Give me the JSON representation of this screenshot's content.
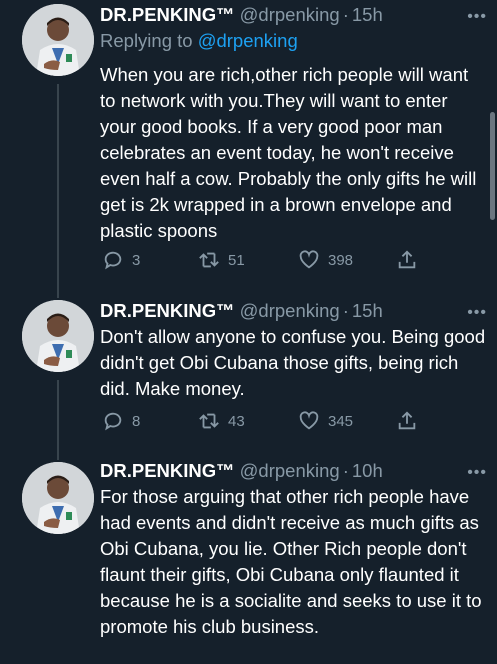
{
  "tweets": [
    {
      "name": "DR.PENKING™",
      "handle": "@drpenking",
      "sep": "·",
      "time": "15h",
      "reply_prefix": "Replying to ",
      "reply_to": "@drpenking",
      "text": "When you are rich,other rich people will want to network with you.They will want to enter your good books. If a very good poor man celebrates an event today, he won't receive even half a cow. Probably the only gifts he will get is 2k wrapped in a brown envelope and plastic spoons",
      "replies": "3",
      "retweets": "51",
      "likes": "398"
    },
    {
      "name": "DR.PENKING™",
      "handle": "@drpenking",
      "sep": "·",
      "time": "15h",
      "text": "Don't allow anyone to confuse you. Being good didn't get Obi Cubana those gifts, being rich did. Make money.",
      "replies": "8",
      "retweets": "43",
      "likes": "345"
    },
    {
      "name": "DR.PENKING™",
      "handle": "@drpenking",
      "sep": "·",
      "time": "10h",
      "text": "For those arguing that other rich people have had events and didn't receive as much gifts as Obi Cubana, you lie. Other Rich people don't flaunt their gifts, Obi Cubana only flaunted it because he is a socialite and seeks to use it to promote his club business."
    }
  ],
  "more_glyph": "•••",
  "colors": {
    "bg": "#15202b",
    "muted": "#8899a6",
    "link": "#1da1f2"
  },
  "icons": [
    "reply-icon",
    "retweet-icon",
    "like-icon",
    "share-icon",
    "more-icon"
  ]
}
